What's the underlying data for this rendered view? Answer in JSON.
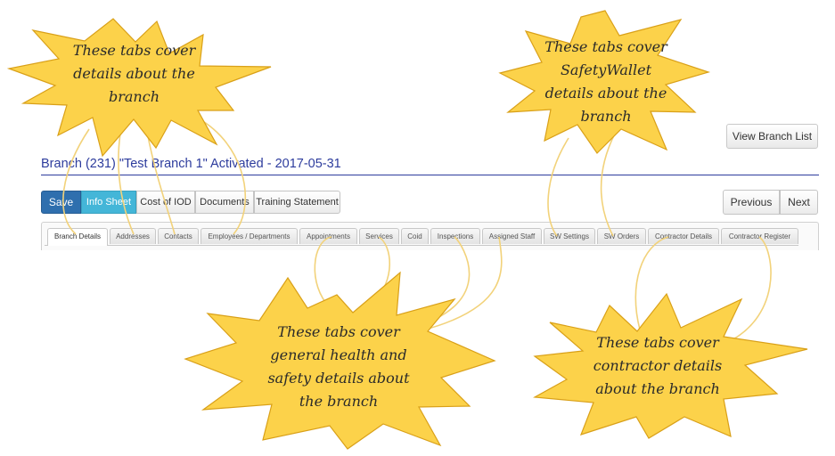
{
  "header": {
    "view_branch_list_label": "View Branch List",
    "title_main": "Branch (231) \"Test Branch 1\" Activated",
    "title_sep": " - ",
    "title_date": "2017-05-31"
  },
  "toolbar": {
    "save_label": "Save",
    "info_sheet_label": "Info Sheet",
    "cost_iod_label": "Cost of IOD",
    "documents_label": "Documents",
    "training_statement_label": "Training Statement",
    "previous_label": "Previous",
    "next_label": "Next"
  },
  "tabs": [
    {
      "label": "Branch Details",
      "active": true
    },
    {
      "label": "Addresses"
    },
    {
      "label": "Contacts"
    },
    {
      "label": "Employees / Departments"
    },
    {
      "label": "Appointments"
    },
    {
      "label": "Services"
    },
    {
      "label": "Coid"
    },
    {
      "label": "Inspections"
    },
    {
      "label": "Assigned Staff"
    },
    {
      "label": "SW Settings"
    },
    {
      "label": "SW Orders"
    },
    {
      "label": "Contractor Details"
    },
    {
      "label": "Contractor Register"
    }
  ],
  "annotations": {
    "branch": "These tabs cover details about the branch",
    "safetywallet": "These tabs cover SafetyWallet details about the branch",
    "health_safety": "These tabs cover general health and safety details about the branch",
    "contractor": "These tabs cover contractor details about the branch"
  },
  "colors": {
    "title": "#2d3c9d",
    "save": "#2f6fae",
    "info_sheet": "#44b6d8",
    "burst_fill": "#fcd24a",
    "burst_stroke": "#d9a018",
    "arrow": "#f2d27a"
  }
}
